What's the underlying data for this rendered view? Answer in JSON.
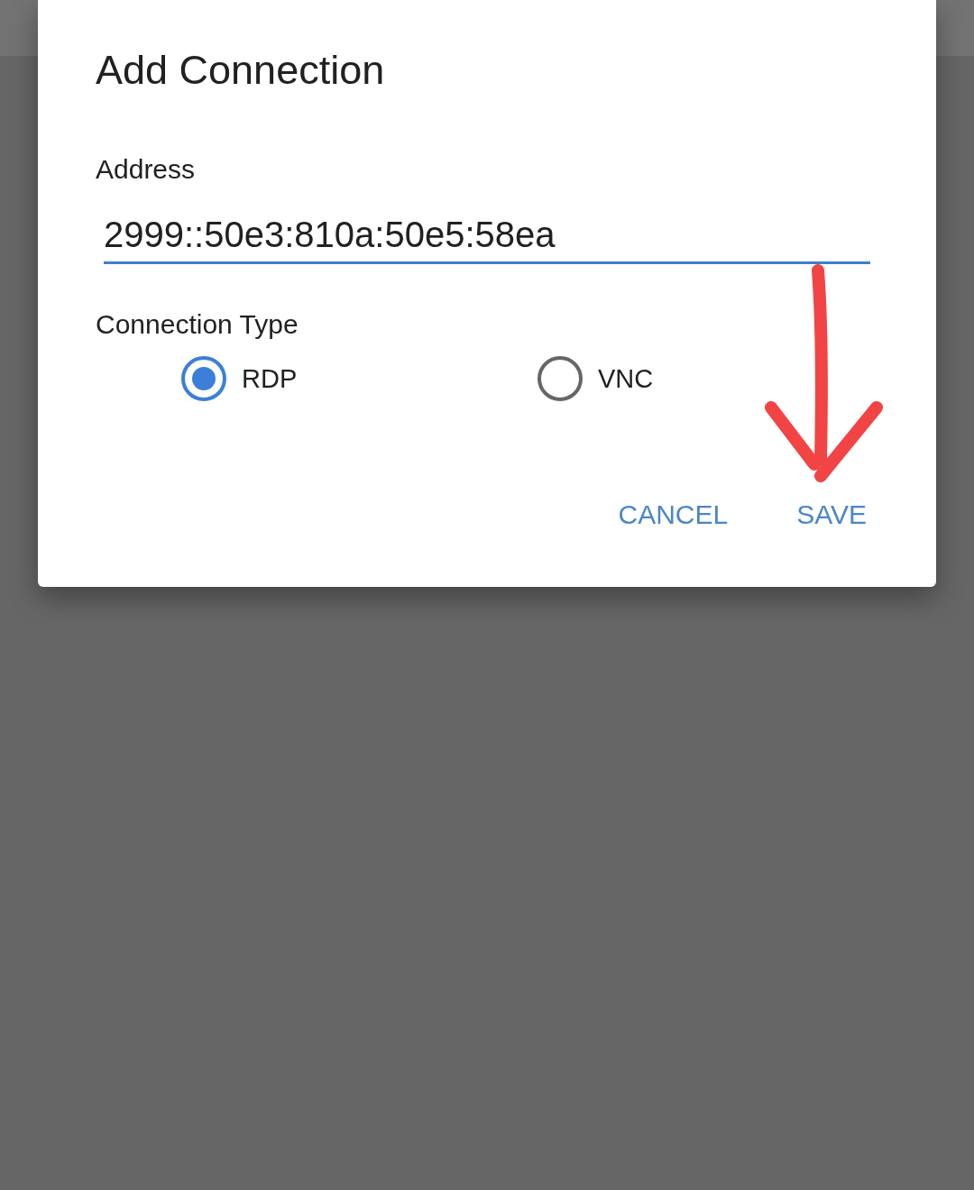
{
  "dialog": {
    "title": "Add Connection",
    "address": {
      "label": "Address",
      "value": "2999::50e3:810a:50e5:58ea",
      "focused": true
    },
    "connection_type": {
      "label": "Connection Type",
      "options": [
        {
          "label": "RDP",
          "selected": true
        },
        {
          "label": "VNC",
          "selected": false
        }
      ]
    },
    "buttons": [
      "CANCEL",
      "SAVE"
    ]
  }
}
